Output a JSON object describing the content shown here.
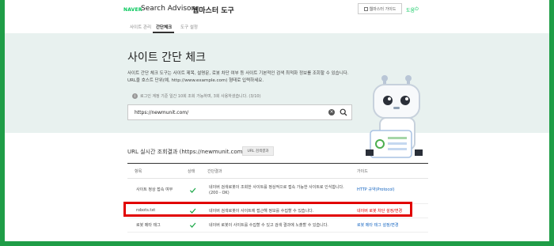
{
  "header": {
    "brand_naver": "NAVER",
    "brand_name": "Search Advisor",
    "tool_name": "웹마스터 도구",
    "guide_button": "웹마스터 가이드",
    "login": "도움"
  },
  "nav": {
    "items": [
      {
        "label": "사이트 관리",
        "active": false
      },
      {
        "label": "간단체크",
        "active": true
      },
      {
        "label": "도구 설정",
        "active": false
      }
    ]
  },
  "hero": {
    "title": "사이트 간단 체크",
    "desc_line1": "사이트 간단 체크 도구는 사이트 제목, 설명문, 로봇 차단 여부 등 사이트 기본적인 검색 최적화 정보를 조회할 수 있습니다.",
    "desc_line2": "URL을 호스트 단위(예, http://www.example.com) 형태로 입력하세요.",
    "notice": "로그인 계정 기준 일간 10회 조회 가능하며, 3회 사용하셨습니다. (3/10)",
    "search_value": "https://newmunit.com/"
  },
  "results": {
    "title": "URL 실시간 조회결과 (https://newmunit.com/)",
    "button": "URL 검색결과",
    "headers": [
      "항목",
      "상태",
      "간단결과",
      "가이드"
    ],
    "rows": [
      {
        "item": "사이트 정상 접속 여부",
        "result1": "네이버 검색로봇이 조회한 사이트를 정상적으로 접속 가능한 사이트로 인식합니다.",
        "result2": "(200 - OK)",
        "guide": "HTTP 규약(Protocol)",
        "highlight": false
      },
      {
        "item": "robots.txt",
        "result1": "네이버 검색로봇이 사이트에 접근해 정보를 수집할 수 있습니다.",
        "result2": "",
        "guide": "네이버 로봇 차단 설정/변경",
        "highlight": true
      },
      {
        "item": "로봇 메타 태그",
        "result1": "네이버 로봇이 사이트를 수집할 수 있고 검색 결과에 노출할 수 있습니다.",
        "result2": "",
        "guide": "로봇 메타 태그 설정/변경",
        "highlight": false
      }
    ]
  },
  "colors": {
    "accent_green": "#03c75a",
    "border_green": "#1f9d47",
    "highlight_red": "#e10000",
    "link_blue": "#1565c0"
  }
}
